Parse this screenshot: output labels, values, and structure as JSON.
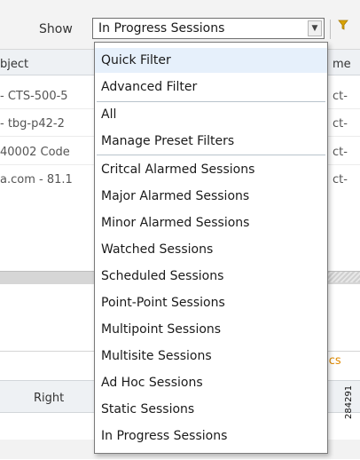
{
  "toolbar": {
    "show_label": "Show",
    "selected_value": "In Progress Sessions",
    "dropdown_arrow": "▼",
    "filter_icon": "funnel-icon"
  },
  "table": {
    "col_object": "bject",
    "col_name": "me",
    "rows": [
      {
        "object": "- CTS-500-5",
        "name": "ct-"
      },
      {
        "object": "- tbg-p42-2",
        "name": "ct-"
      },
      {
        "object": "40002 Code",
        "name": "ct-"
      },
      {
        "object": "a.com - 81.1",
        "name": "ct-"
      }
    ]
  },
  "lower_pane": {
    "stats_link": "tics",
    "right_label": "Right"
  },
  "figure_id": "284291",
  "dropdown": {
    "items": [
      {
        "label": "Quick Filter"
      },
      {
        "label": "Advanced Filter"
      },
      {
        "label": "All"
      },
      {
        "label": "Manage Preset Filters"
      },
      {
        "label": "Critcal Alarmed Sessions"
      },
      {
        "label": "Major Alarmed Sessions"
      },
      {
        "label": "Minor Alarmed Sessions"
      },
      {
        "label": "Watched Sessions"
      },
      {
        "label": "Scheduled Sessions"
      },
      {
        "label": "Point-Point Sessions"
      },
      {
        "label": "Multipoint Sessions"
      },
      {
        "label": "Multisite Sessions"
      },
      {
        "label": "Ad Hoc Sessions"
      },
      {
        "label": "Static Sessions"
      },
      {
        "label": "In Progress Sessions"
      }
    ]
  },
  "colors": {
    "highlight": "#e6f0fb",
    "link": "#e08a00",
    "funnel": "#c89100"
  }
}
